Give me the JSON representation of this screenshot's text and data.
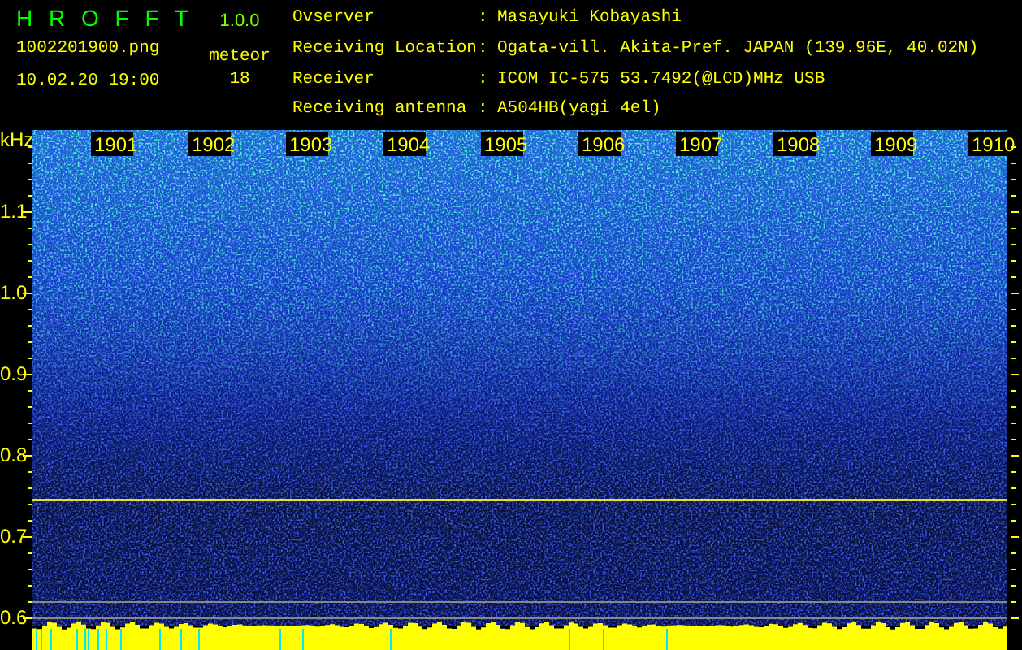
{
  "app": {
    "title": "H R O F F T",
    "version": "1.0.0"
  },
  "file": {
    "name": "1002201900.png",
    "datetime": "10.02.20 19:00"
  },
  "meteor": {
    "label": "meteor",
    "count": "18"
  },
  "info": [
    {
      "label": "Ovserver",
      "separator": ":",
      "value": "Masayuki Kobayashi"
    },
    {
      "label": "Receiving Location",
      "separator": ":",
      "value": "Ogata-vill. Akita-Pref. JAPAN (139.96E, 40.02N)"
    },
    {
      "label": "Receiver",
      "separator": ":",
      "value": "ICOM IC-575 53.7492(@LCD)MHz USB"
    },
    {
      "label": "Receiving antenna",
      "separator": ":",
      "value": "A504HB(yagi 4el)"
    }
  ],
  "spectrogram": {
    "unit": "kHz",
    "y_labels": [
      "1.1",
      "1.0",
      "0.9",
      "0.8",
      "0.7",
      "0.6"
    ],
    "time_labels": [
      "1901",
      "1902",
      "1903",
      "1904",
      "1905",
      "1906",
      "1907",
      "1908",
      "1909",
      "1910"
    ]
  }
}
